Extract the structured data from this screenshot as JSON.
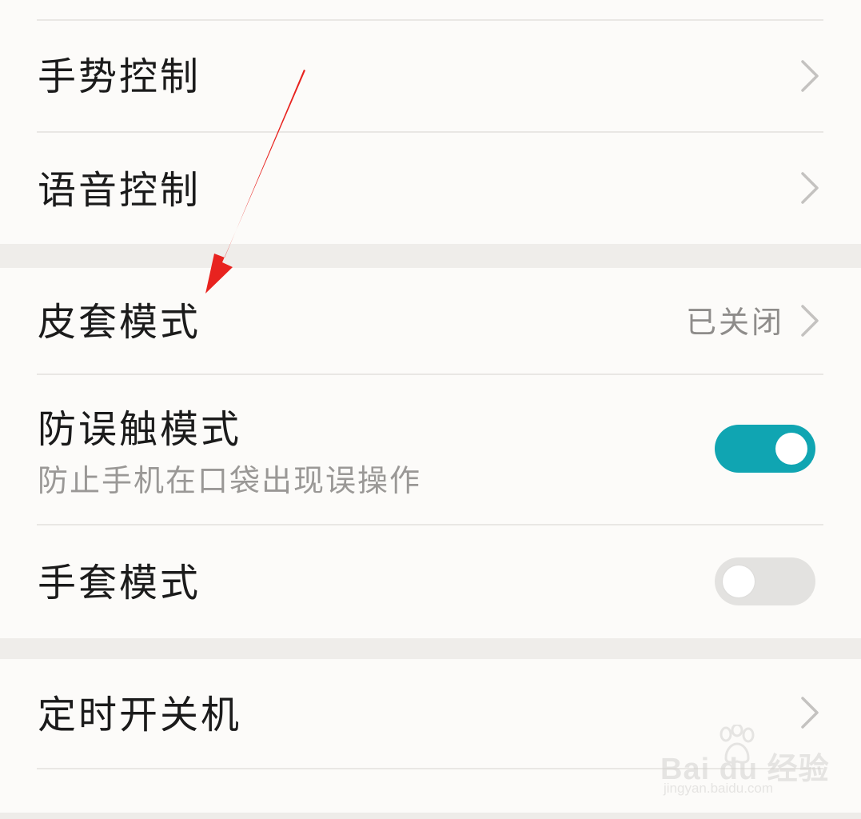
{
  "settings": {
    "group1": [
      {
        "title": "手势控制",
        "has_chevron": true
      },
      {
        "title": "语音控制",
        "has_chevron": true
      }
    ],
    "group2": [
      {
        "title": "皮套模式",
        "value": "已关闭",
        "has_chevron": true
      },
      {
        "title": "防误触模式",
        "subtitle": "防止手机在口袋出现误操作",
        "toggle_state": "on"
      },
      {
        "title": "手套模式",
        "toggle_state": "off"
      }
    ],
    "group3": [
      {
        "title": "定时开关机",
        "has_chevron": true
      }
    ]
  },
  "icons": {
    "chevron": "chevron-right-icon",
    "annotation": "red-arrow-annotation",
    "watermark": "baidu-paw-icon"
  },
  "watermark": {
    "brand": "Bai du 经验",
    "url": "jingyan.baidu.com"
  },
  "colors": {
    "toggle_on": "#10a5b2",
    "toggle_off": "#e3e2e0",
    "arrow": "#e8231f",
    "secondary_text": "#9a9896"
  }
}
